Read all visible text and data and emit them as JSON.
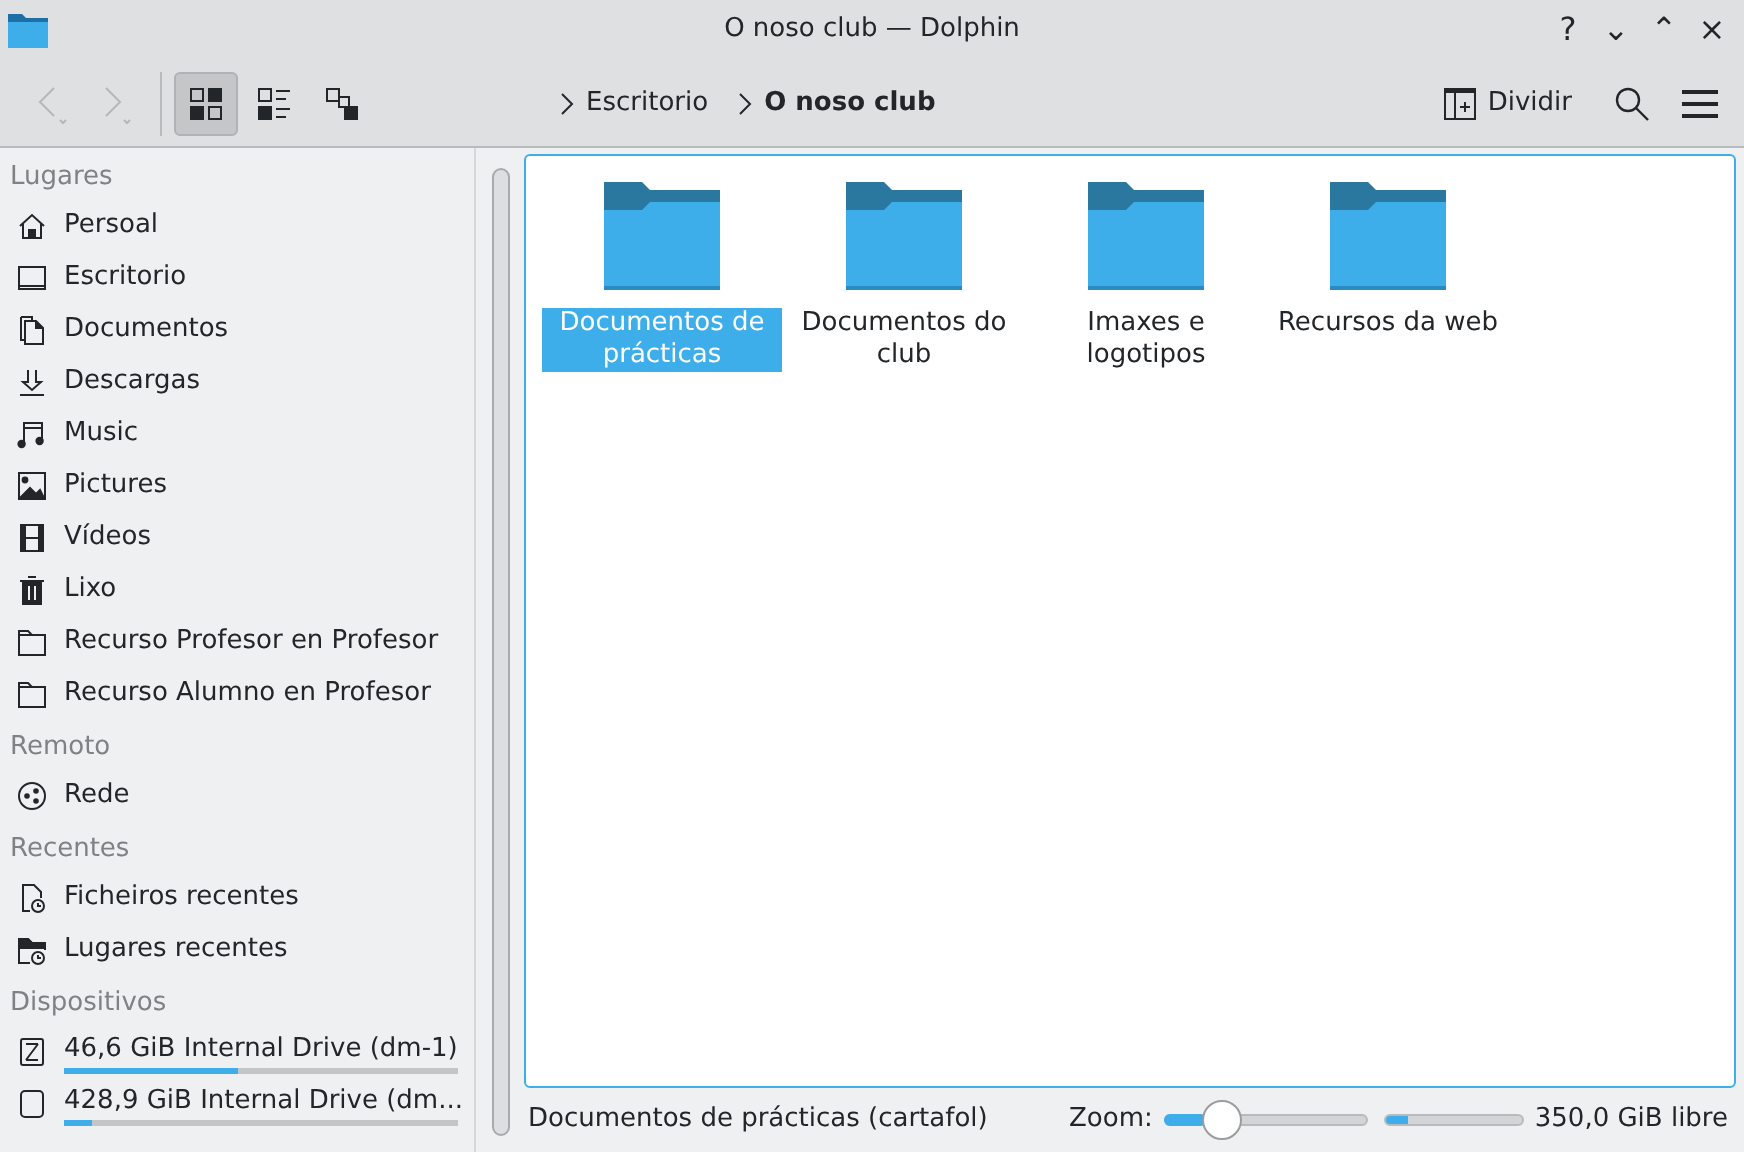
{
  "window": {
    "title": "O noso club — Dolphin",
    "controls": [
      "?",
      "⌄",
      "⌃",
      "×"
    ]
  },
  "toolbar": {
    "nav": [
      {
        "kind": "back",
        "disabled": true
      },
      {
        "kind": "forward",
        "disabled": true
      }
    ],
    "views": [
      {
        "kind": "icons",
        "selected": true
      },
      {
        "kind": "compact",
        "selected": false
      },
      {
        "kind": "tree",
        "selected": false
      }
    ],
    "breadcrumb": [
      {
        "label": "Escritorio",
        "selected": false
      },
      {
        "label": "O noso club",
        "selected": true
      }
    ],
    "split": {
      "label": "Dividir"
    }
  },
  "sidebar": {
    "sections": [
      {
        "title": "Lugares",
        "items": [
          {
            "label": "Persoal"
          },
          {
            "label": "Escritorio"
          },
          {
            "label": "Documentos"
          },
          {
            "label": "Descargas"
          },
          {
            "label": "Music"
          },
          {
            "label": "Pictures"
          },
          {
            "label": "Vídeos"
          },
          {
            "label": "Lixo"
          },
          {
            "label": "Recurso Profesor en Profesor"
          },
          {
            "label": "Recurso Alumno en Profesor"
          }
        ]
      },
      {
        "title": "Remoto",
        "items": [
          {
            "label": "Rede"
          }
        ]
      },
      {
        "title": "Recentes",
        "items": [
          {
            "label": "Ficheiros recentes"
          },
          {
            "label": "Lugares recentes"
          }
        ]
      },
      {
        "title": "Dispositivos",
        "items": [
          {
            "label": "46,6 GiB Internal Drive (dm-1)",
            "level": 0.44
          },
          {
            "label": "428,9 GiB Internal Drive (dm...",
            "level": 0.07
          }
        ]
      }
    ]
  },
  "folders": [
    {
      "name": "Documentos de prácticas",
      "selected": true
    },
    {
      "name": "Documentos do club",
      "selected": false
    },
    {
      "name": "Imaxes e logotipos",
      "selected": false
    },
    {
      "name": "Recursos da web",
      "selected": false
    }
  ],
  "status_bar": {
    "text": "Documentos de prácticas (cartafol)",
    "zoom_label": "Zoom:",
    "zoom": {
      "level": 0.2
    },
    "free_space": {
      "level": 0.15
    },
    "free_label": "350,0 GiB libre"
  }
}
